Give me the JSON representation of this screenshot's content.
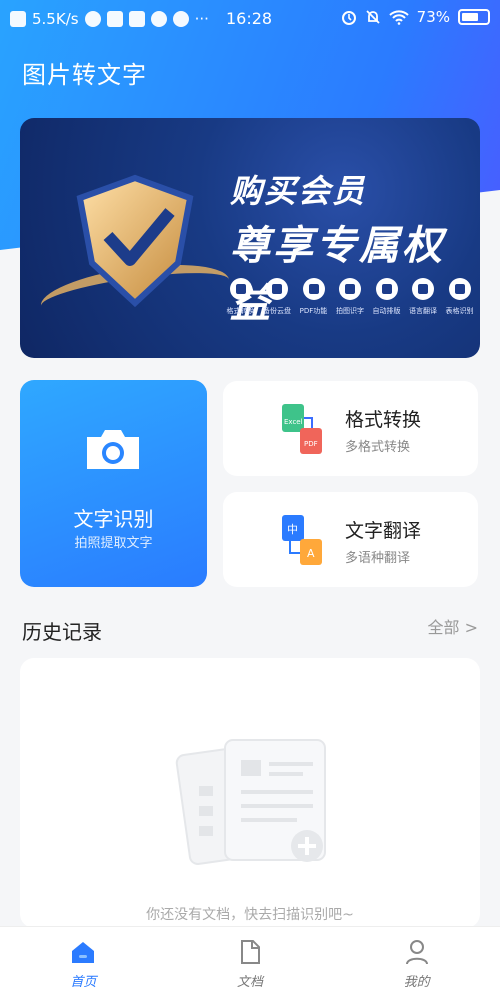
{
  "status_bar": {
    "speed": "5.5K/s",
    "time": "16:28",
    "battery": "73%",
    "battery_level": 0.73,
    "more": "···"
  },
  "app": {
    "title": "图片转文字"
  },
  "banner": {
    "line1": "购买会员",
    "line2": "尊享专属权益",
    "perks": [
      {
        "label": "格式转换",
        "icon": "diamond-icon"
      },
      {
        "label": "备份云盘",
        "icon": "cloud-upload-icon"
      },
      {
        "label": "PDF功能",
        "icon": "pdf-icon"
      },
      {
        "label": "拍图识字",
        "icon": "photo-text-icon"
      },
      {
        "label": "自动排版",
        "icon": "layout-icon"
      },
      {
        "label": "语言翻译",
        "icon": "translate-icon"
      },
      {
        "label": "表格识别",
        "icon": "table-icon"
      }
    ]
  },
  "ocr": {
    "title": "文字识别",
    "subtitle": "拍照提取文字",
    "icon": "camera-icon"
  },
  "format_convert": {
    "title": "格式转换",
    "subtitle": "多格式转换",
    "icon_top": "Excel",
    "icon_bottom": "PDF"
  },
  "translate": {
    "title": "文字翻译",
    "subtitle": "多语种翻译",
    "icon_top": "中",
    "icon_bottom": "A"
  },
  "history": {
    "title": "历史记录",
    "all_label": "全部 >",
    "empty_text": "你还没有文档，快去扫描识别吧~"
  },
  "tabs": [
    {
      "label": "首页",
      "icon": "home-icon",
      "active": true
    },
    {
      "label": "文档",
      "icon": "document-icon",
      "active": false
    },
    {
      "label": "我的",
      "icon": "profile-icon",
      "active": false
    }
  ],
  "colors": {
    "primary": "#2b7bff",
    "banner_bg": "#183a84",
    "gold": "#d6a864"
  }
}
